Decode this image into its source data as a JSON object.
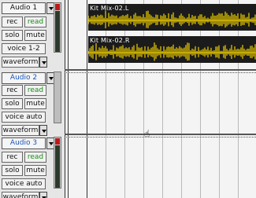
{
  "tracks": [
    {
      "name": "Audio 1",
      "selected": false,
      "rec": "rec",
      "read": "read",
      "solo": "solo",
      "mute": "mute",
      "voice": "voice 1-2",
      "view": "waveform"
    },
    {
      "name": "Audio 2",
      "selected": true,
      "rec": "rec",
      "read": "read",
      "solo": "solo",
      "mute": "mute",
      "voice": "voice auto",
      "view": "waveform"
    },
    {
      "name": "Audio 3",
      "selected": true,
      "rec": "rec",
      "read": "read",
      "solo": "solo",
      "mute": "mute",
      "voice": "voice auto",
      "view": "waveform"
    }
  ],
  "regions": [
    {
      "name": "Kit Mix-02.L",
      "color": "#f0d000"
    },
    {
      "name": "Kit Mix-02.R",
      "color": "#f0d000"
    }
  ],
  "cursor": {
    "icon": "grabber-hand-icon",
    "glyph": "☝"
  },
  "colors": {
    "read_text": "#1a8a1a",
    "selected_name": "#1a55b8",
    "waveform": "#f0d000"
  }
}
